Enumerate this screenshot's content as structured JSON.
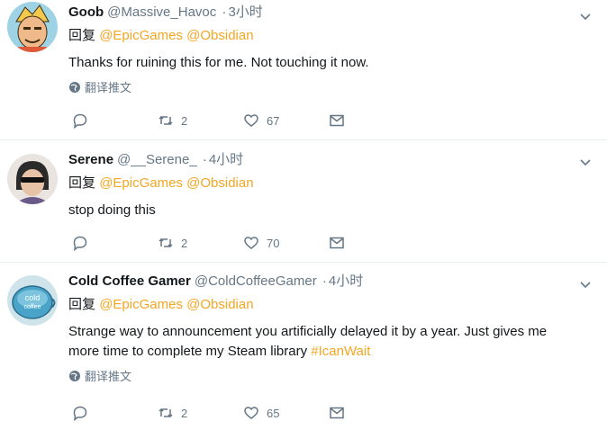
{
  "reply_prefix": "回复",
  "translate_label": "翻译推文",
  "mention_color": "#f5a623",
  "tweets": [
    {
      "name": "Goob",
      "handle": "@Massive_Havoc",
      "dot": "·",
      "time": "3小时",
      "mentions": [
        "@EpicGames",
        "@Obsidian"
      ],
      "text": "Thanks for ruining this for me. Not touching it now.",
      "retweets": "2",
      "likes": "67",
      "avatar": "cartoon-avatar"
    },
    {
      "name": "Serene",
      "handle": "@__Serene_",
      "dot": "·",
      "time": "4小时",
      "mentions": [
        "@EpicGames",
        "@Obsidian"
      ],
      "text": "stop doing this",
      "retweets": "2",
      "likes": "70",
      "avatar": "sunglasses-avatar"
    },
    {
      "name": "Cold Coffee Gamer",
      "handle": "@ColdCoffeeGamer",
      "dot": "·",
      "time": "4小时",
      "mentions": [
        "@EpicGames",
        "@Obsidian"
      ],
      "text_line1": "Strange way to announcement you artificially delayed it by a year. Just gives me",
      "text_line2": "more time to complete my Steam library",
      "hashtag": "#IcanWait",
      "retweets": "2",
      "likes": "65",
      "avatar_text": "cold\ncoffee",
      "avatar": "coffee-cup-avatar"
    }
  ]
}
